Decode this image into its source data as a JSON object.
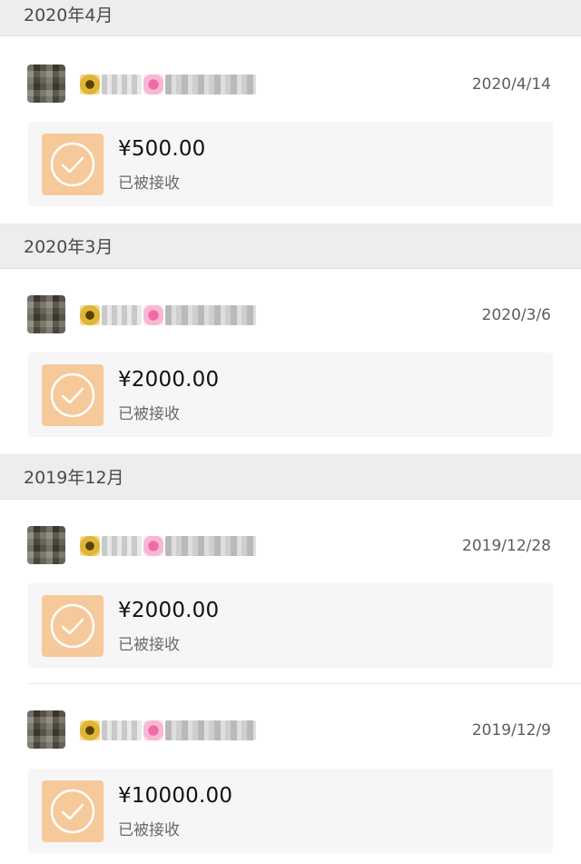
{
  "sections": [
    {
      "header": "2020年4月",
      "entries": [
        {
          "date": "2020/4/14",
          "amount": "¥500.00",
          "status": "已被接收"
        }
      ]
    },
    {
      "header": "2020年3月",
      "entries": [
        {
          "date": "2020/3/6",
          "amount": "¥2000.00",
          "status": "已被接收"
        }
      ]
    },
    {
      "header": "2019年12月",
      "entries": [
        {
          "date": "2019/12/28",
          "amount": "¥2000.00",
          "status": "已被接收"
        },
        {
          "date": "2019/12/9",
          "amount": "¥10000.00",
          "status": "已被接收"
        }
      ]
    }
  ],
  "icons": {
    "received": "check-circle-icon",
    "nickname_emoji_1": "sunflower-icon",
    "nickname_emoji_2": "flower-icon"
  },
  "colors": {
    "accent_icon_bg": "#f6c99a",
    "section_header_bg": "#ededed",
    "card_bg": "#f6f6f6"
  }
}
